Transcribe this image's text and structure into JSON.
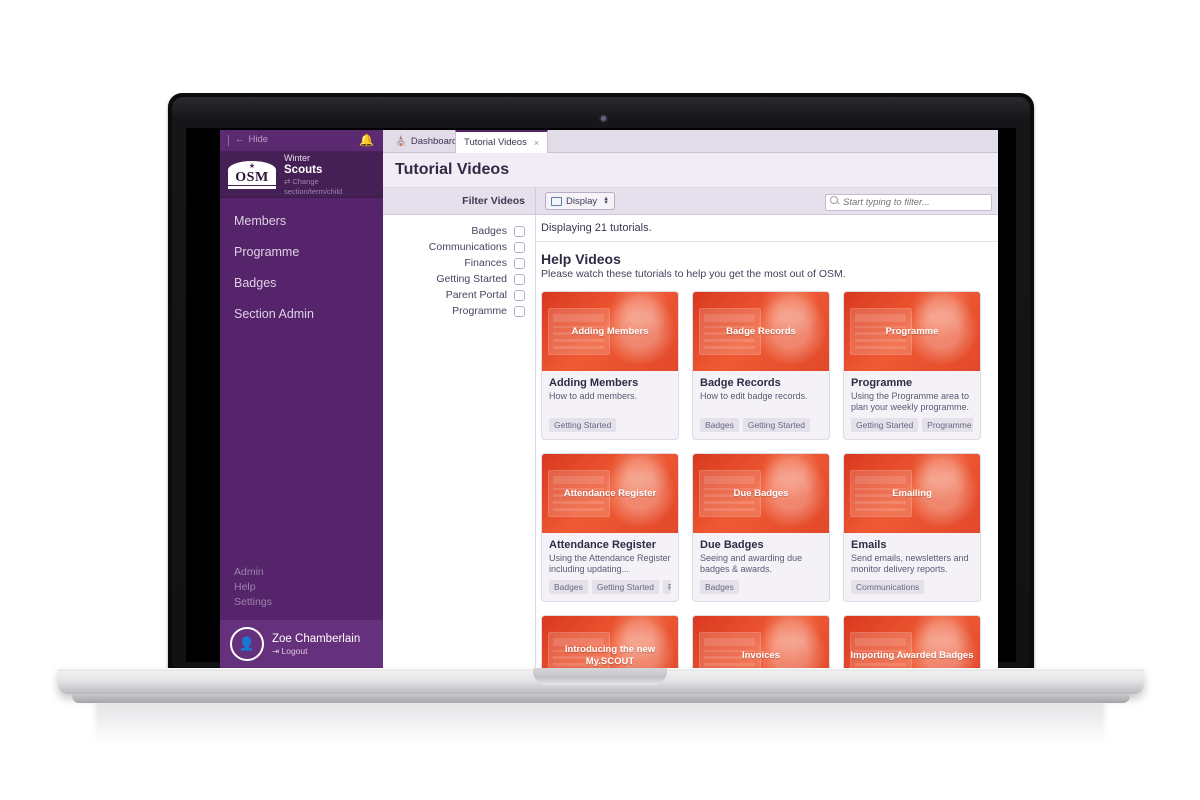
{
  "sidebar": {
    "hide_label": "Hide",
    "bell_icon": "bell-icon",
    "brand": {
      "logo_word": "OSM",
      "line1": "Winter",
      "line2": "Scouts",
      "line3": "Change section/term/child"
    },
    "nav": [
      {
        "label": "Members"
      },
      {
        "label": "Programme"
      },
      {
        "label": "Badges"
      },
      {
        "label": "Section Admin"
      }
    ],
    "nav_bottom": [
      {
        "label": "Admin"
      },
      {
        "label": "Help"
      },
      {
        "label": "Settings"
      }
    ],
    "user": {
      "name": "Zoe Chamberlain",
      "logout": "Logout"
    }
  },
  "tabs": [
    {
      "label": "Dashboard",
      "icon": "home-icon",
      "active": false
    },
    {
      "label": "Tutorial Videos",
      "close": "×",
      "active": true
    }
  ],
  "page": {
    "title": "Tutorial Videos"
  },
  "toolbar": {
    "filter_label": "Filter Videos",
    "display_label": "Display",
    "display_icon": "monitor-icon",
    "search_placeholder": "Start typing to filter...",
    "search_value": "",
    "search_icon": "search-icon"
  },
  "filters": [
    {
      "label": "Badges",
      "checked": false
    },
    {
      "label": "Communications",
      "checked": false
    },
    {
      "label": "Finances",
      "checked": false
    },
    {
      "label": "Getting Started",
      "checked": false
    },
    {
      "label": "Parent Portal",
      "checked": false
    },
    {
      "label": "Programme",
      "checked": false
    }
  ],
  "content": {
    "displaying": "Displaying 21 tutorials.",
    "section_title": "Help Videos",
    "section_subtitle": "Please watch these tutorials to help you get the most out of OSM."
  },
  "videos": [
    {
      "thumb_title": "Adding Members",
      "title": "Adding Members",
      "desc": "How to add members.",
      "tags": [
        "Getting Started"
      ]
    },
    {
      "thumb_title": "Badge Records",
      "title": "Badge Records",
      "desc": "How to edit badge records.",
      "tags": [
        "Badges",
        "Getting Started"
      ]
    },
    {
      "thumb_title": "Programme",
      "title": "Programme",
      "desc": "Using the Programme area to plan your weekly programme.",
      "tags": [
        "Getting Started",
        "Programme"
      ]
    },
    {
      "thumb_title": "Attendance Register",
      "title": "Attendance Register",
      "desc": "Using the Attendance Register including updating...",
      "tags": [
        "Badges",
        "Getting Started",
        "Programme"
      ]
    },
    {
      "thumb_title": "Due Badges",
      "title": "Due Badges",
      "desc": "Seeing and awarding due badges & awards.",
      "tags": [
        "Badges"
      ]
    },
    {
      "thumb_title": "Emailing",
      "title": "Emails",
      "desc": "Send emails, newsletters and monitor delivery reports.",
      "tags": [
        "Communications"
      ]
    },
    {
      "thumb_title": "Introducing the new My.SCOUT",
      "title": "",
      "desc": "",
      "tags": []
    },
    {
      "thumb_title": "Invoices",
      "title": "",
      "desc": "",
      "tags": []
    },
    {
      "thumb_title": "Importing Awarded Badges",
      "title": "",
      "desc": "",
      "tags": []
    }
  ],
  "colors": {
    "sidebar": "#56246a",
    "sidebar_dark": "#452055",
    "accent_red": "#e8462a",
    "chrome": "#e6dfec",
    "text_dark": "#2f2b44"
  }
}
